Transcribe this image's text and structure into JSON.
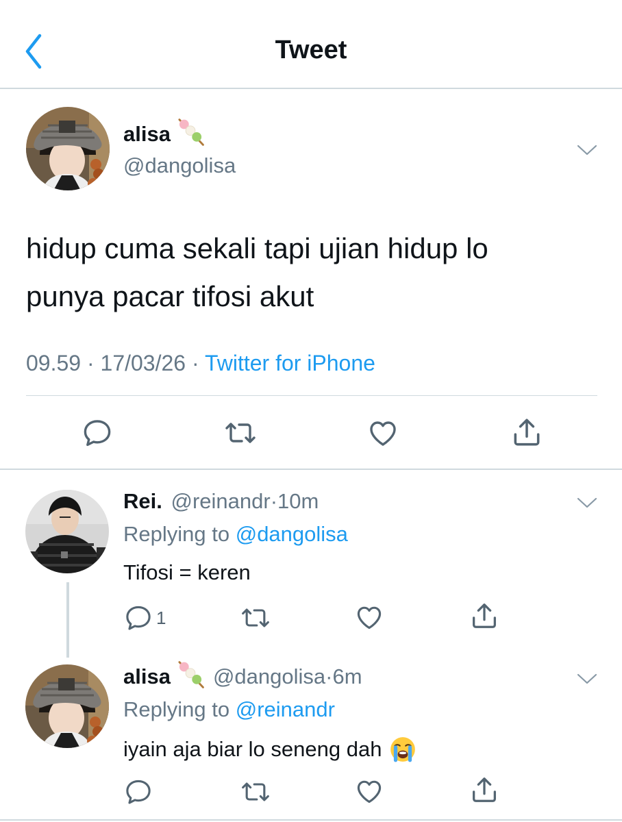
{
  "header": {
    "title": "Tweet"
  },
  "tweet": {
    "display_name": "alisa",
    "handle": "@dangolisa",
    "text_line1": "hidup cuma sekali tapi ujian hidup lo",
    "text_line2": "punya pacar tifosi akut",
    "time": "09.59",
    "sep1": "·",
    "date": "17/03/26",
    "sep2": "·",
    "source": "Twitter for iPhone"
  },
  "replies": [
    {
      "display_name": "Rei.",
      "handle": "@reinandr",
      "dot": "·",
      "age": "10m",
      "replying_prefix": "Replying to",
      "replying_handle": "@dangolisa",
      "text": "Tifosi = keren",
      "reply_count": "1"
    },
    {
      "display_name": "alisa",
      "handle": "@dangolisa",
      "dot": "·",
      "age": "6m",
      "replying_prefix": "Replying to",
      "replying_handle": "@reinandr",
      "text": "iyain aja biar lo seneng dah",
      "reply_count": ""
    }
  ],
  "icons": {
    "back": "chevron-left-icon",
    "more": "chevron-down-icon",
    "reply": "speech-bubble-icon",
    "retweet": "retweet-arrows-icon",
    "like": "heart-icon",
    "share": "share-upload-icon",
    "emoji_dango": "dango-emoji",
    "emoji_crying": "loudly-crying-face-emoji"
  },
  "colors": {
    "accent": "#1d9bf0",
    "secondary_text": "#657786",
    "divider": "#cfd9de",
    "icon": "#536471"
  }
}
